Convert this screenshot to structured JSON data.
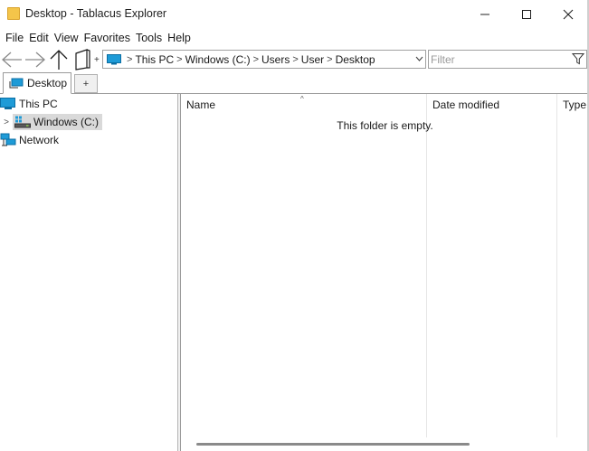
{
  "window": {
    "title": "Desktop - Tablacus Explorer",
    "minimize_glyph": "—",
    "maximize_glyph": "☐",
    "close_glyph": "✕"
  },
  "menu": [
    "File",
    "Edit",
    "View",
    "Favorites",
    "Tools",
    "Help"
  ],
  "toolbar": {
    "new_tab_glyph": "+"
  },
  "address": {
    "crumbs": [
      "This PC",
      "Windows (C:)",
      "Users",
      "User",
      "Desktop"
    ],
    "separator": ">"
  },
  "filter": {
    "placeholder": "Filter",
    "value": ""
  },
  "tabs": {
    "active_label": "Desktop",
    "add_label": "+"
  },
  "tree": {
    "items": [
      {
        "label": "This PC"
      },
      {
        "label": "Windows (C:)"
      },
      {
        "label": "Network"
      }
    ],
    "expand_glyph": ">"
  },
  "list": {
    "columns": [
      "Name",
      "Date modified",
      "Type"
    ],
    "sort_glyph": "^",
    "empty_message": "This folder is empty."
  },
  "colors": {
    "folder_yellow": "#f4c54a",
    "pc_blue": "#1e9bd7",
    "selection_gray": "#d9d9d9"
  },
  "icons": {
    "title": "folder-icon",
    "back": "back-arrow-icon",
    "forward": "forward-arrow-icon",
    "up": "up-arrow-icon",
    "tab": "tab-icon",
    "filter": "filter-icon",
    "this_pc": "monitor-icon",
    "drive": "drive-icon",
    "network": "network-icon"
  }
}
